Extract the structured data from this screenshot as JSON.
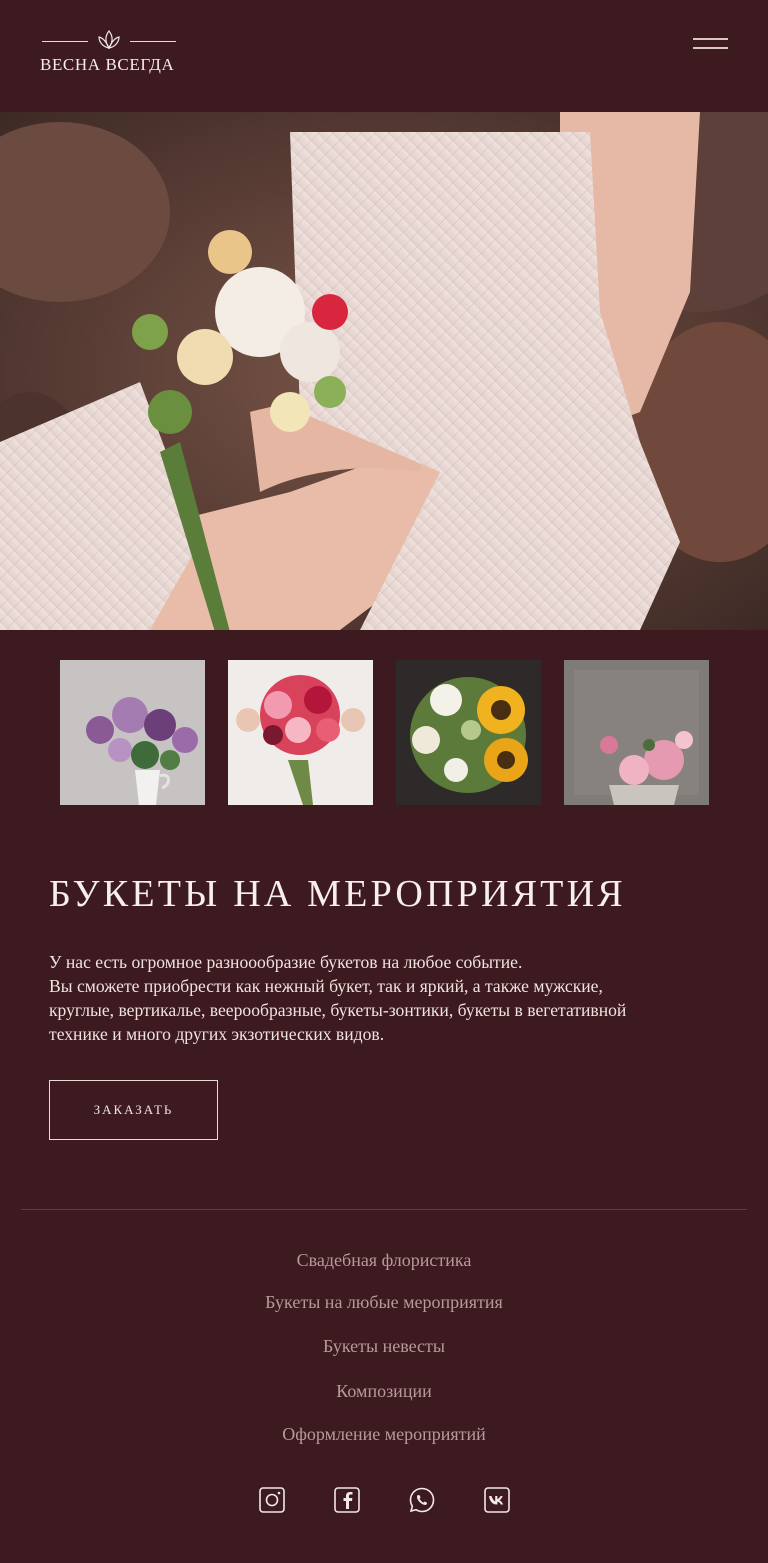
{
  "header": {
    "brand": "ВЕСНА ВСЕГДА"
  },
  "gallery": {
    "thumbs": [
      {
        "subject": "purple-flowers-in-jug"
      },
      {
        "subject": "red-pink-bridal-bouquet"
      },
      {
        "subject": "sunflower-bouquet"
      },
      {
        "subject": "pink-peonies"
      }
    ]
  },
  "content": {
    "title": "БУКЕТЫ НА МЕРОПРИЯТИЯ",
    "lines": [
      "У нас есть огромное разноообразие букетов на любое событие.",
      "Вы сможете приобрести как нежный букет, так и яркий, а также мужские,",
      "круглые, вертикалье, веерообразные, букеты-зонтики, букеты в вегетативной",
      "технике и много  других экзотических видов."
    ],
    "order_label": "ЗАКАЗАТЬ"
  },
  "footer": {
    "links": [
      "Свадебная флористика",
      "Букеты на любые мероприятия",
      "Букеты невесты",
      "Композиции",
      "Оформление мероприятий"
    ],
    "socials": [
      "instagram-icon",
      "facebook-icon",
      "whatsapp-icon",
      "vk-icon"
    ]
  },
  "colors": {
    "background": "#3c1a20",
    "text": "#f2e8e6",
    "muted_link": "#b89a9a"
  }
}
